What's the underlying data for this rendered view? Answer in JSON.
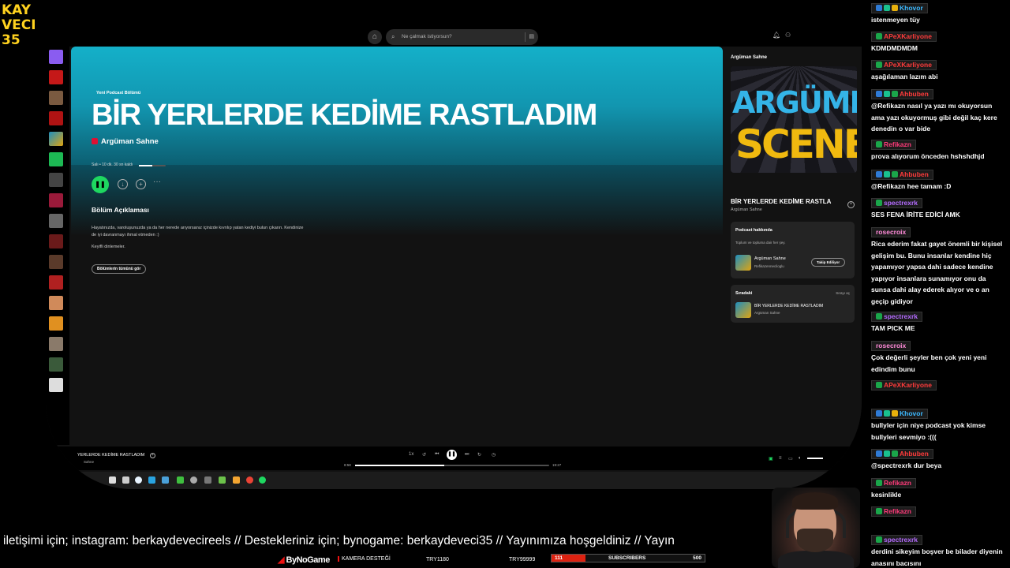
{
  "overlay": {
    "logo_lines": [
      "KAY",
      "VECI",
      "35"
    ],
    "ticker": "iletişimi için; instagram: berkaydevecireels // Destekleriniz için; bynogame: berkaydeveci35 // Yayınımıza hoşgeldiniz // Yayın",
    "bottom_logo": "ByNoGame",
    "kamera": "KAMERA DESTEĞİ",
    "try1": "TRY1180",
    "try2": "TRY99999",
    "subs_current": "111",
    "subs_label": "SUBSCRIBERS",
    "subs_goal": "500",
    "subs_progress_fraction": 0.22
  },
  "spotify": {
    "search_placeholder": "Ne çalmak istiyorsun?",
    "episode": {
      "type_label": "Yeni Podcast Bölümü",
      "title": "BİR YERLERDE KEDİME RASTLADIM",
      "show": "Argüman Sahne",
      "meta": "Salı • 10 dk. 30 sn kaldı",
      "progress_fraction": 0.5,
      "desc_heading": "Bölüm Açıklaması",
      "desc_text": "Hayatınızda, varoluşunuzda ya da her nerede arıyorsanız içinizde kıvrılıp yatan kediyi bulun çıkarın. Kendinize de iyi davranmayı ihmal etmeden :)",
      "desc_thanks": "Keyifli dinlemeler.",
      "all_episodes_button": "Bölümlerin tümünü gör"
    },
    "right_panel": {
      "header": "Argüman Sahne",
      "cover_word1": "ARGÜMEN",
      "cover_word2": "SCENE",
      "title": "BİR YERLERDE KEDİME RASTLA",
      "subtitle": "Argüman Sahne",
      "about_heading": "Podcast hakkında",
      "about_text": "Toplum ve topluma dair her şey.",
      "about_name": "Argüman Sahne",
      "about_creator": "Refikazenneciloglu",
      "follow_label": "Takip Ediliyor",
      "queue_heading": "Sıradaki",
      "queue_open": "Sırayı aç",
      "queue_title": "BİR YERLERDE KEDİME RASTLADIM",
      "queue_sub": "Argüman Sahne"
    },
    "player": {
      "now_title": "YERLERDE KEDİME RASTLADIM",
      "now_sub": "Sahne",
      "speed": "1x",
      "elapsed": "8:58",
      "remaining": "19:27",
      "progress_fraction": 0.46
    }
  },
  "chat": {
    "messages": [
      {
        "user": "Khovor",
        "color": "#3cb9ff",
        "badges": [
          "#2f7bd6",
          "#19c18f",
          "#e8b00c"
        ],
        "text": "istenmeyen tüy"
      },
      {
        "user": "APeXKarliyone",
        "color": "#ff3b3b",
        "badges": [
          "#1aa64a"
        ],
        "text": "KDMDMDMDM"
      },
      {
        "user": "APeXKarliyone",
        "color": "#ff3b3b",
        "badges": [
          "#1aa64a"
        ],
        "text": "aşağılaman lazım abi"
      },
      {
        "user": "Ahbuben",
        "color": "#ff3b3b",
        "badges": [
          "#2f7bd6",
          "#19c18f",
          "#1aa64a"
        ],
        "text": "@Refikazn nasıl ya yazı mı okuyorsun ama yazı okuyormuş gibi değil kaç kere denedin o var bide"
      },
      {
        "user": "Refikazn",
        "color": "#ff3b7a",
        "badges": [
          "#1aa64a"
        ],
        "text": "prova alıyorum önceden hshshdhjd"
      },
      {
        "user": "Ahbuben",
        "color": "#ff3b3b",
        "badges": [
          "#2f7bd6",
          "#19c18f",
          "#1aa64a"
        ],
        "text": "@Refikazn hee tamam :D"
      },
      {
        "user": "spectrexrk",
        "color": "#b46bff",
        "badges": [
          "#1aa64a"
        ],
        "text": "SES FENA İRİTE EDİCİ AMK"
      },
      {
        "user": "rosecroix",
        "color": "#ff8ad8",
        "badges": [],
        "text": "Rica ederim fakat gayet önemli bir kişisel gelişim bu. Bunu insanlar kendine hiç yapamıyor yapsa dahi sadece kendine yapıyor insanlara sunamıyor onu da sunsa dahi alay ederek alıyor ve o an geçip gidiyor"
      },
      {
        "user": "spectrexrk",
        "color": "#b46bff",
        "badges": [
          "#1aa64a"
        ],
        "text": "TAM PICK ME"
      },
      {
        "user": "rosecroix",
        "color": "#ff8ad8",
        "badges": [],
        "text": "Çok değerli şeyler ben çok yeni yeni edindim bunu"
      },
      {
        "user": "APeXKarliyone",
        "color": "#ff3b3b",
        "badges": [
          "#1aa64a"
        ],
        "text": ""
      },
      {
        "user": "Khovor",
        "color": "#3cb9ff",
        "badges": [
          "#2f7bd6",
          "#19c18f",
          "#e8b00c"
        ],
        "text": "bullyler için niye podcast yok kimse bullyleri sevmiyo :((("
      },
      {
        "user": "Ahbuben",
        "color": "#ff3b3b",
        "badges": [
          "#2f7bd6",
          "#19c18f",
          "#1aa64a"
        ],
        "text": "@spectrexrk dur beya"
      },
      {
        "user": "Refikazn",
        "color": "#ff3b7a",
        "badges": [
          "#1aa64a"
        ],
        "text": "kesinlikle"
      },
      {
        "user": "Refikazn",
        "color": "#ff3b7a",
        "badges": [
          "#1aa64a"
        ],
        "text": ""
      },
      {
        "user": "spectrexrk",
        "color": "#b46bff",
        "badges": [
          "#1aa64a"
        ],
        "text": "derdini sikeyim boşver be bilader diyenin anasını bacısını"
      }
    ]
  }
}
